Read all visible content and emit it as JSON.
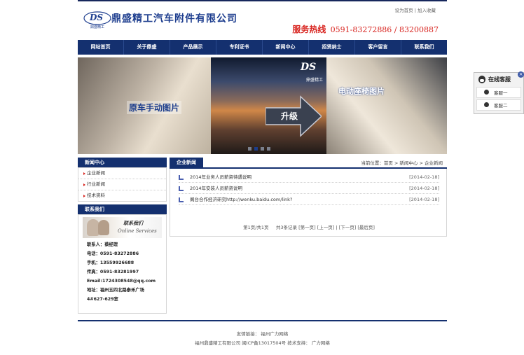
{
  "header": {
    "logo_text": "DS",
    "logo_sub": "鼎盛精工",
    "company_name": "鼎盛精工汽车附件有限公司",
    "links": [
      "设为首页",
      "加入收藏"
    ],
    "hotline_label": "服务热线",
    "hotline_numbers": "0591-83272886 / 83200887"
  },
  "nav": [
    "网站首页",
    "关于鼎盛",
    "产品展示",
    "专利证书",
    "新闻中心",
    "招贤纳士",
    "客户留言",
    "联系我们"
  ],
  "banner": {
    "logo_text": "DS",
    "logo_sub": "鼎盛精工",
    "left_caption": "原车手动图片",
    "right_caption": "电动座椅图片",
    "center_caption": "升级",
    "slides": 4,
    "active_slide": 2
  },
  "sidebar": {
    "news_title": "新闻中心",
    "news_items": [
      "企业新闻",
      "行业新闻",
      "技术资料"
    ],
    "contact_title": "联系我们",
    "contact_image_title": "联系我们",
    "contact_image_sub": "Online Services",
    "contact_lines": [
      "联系人：蔡经理",
      "电话：0591-83272886",
      "手机：13559926688",
      "传真：0591-83281997",
      "Email:1724308548@qq.com",
      "地址：福州五四北路泰禾广场",
      "4#627-629室"
    ]
  },
  "main": {
    "section_title": "企业新闻",
    "breadcrumb": "当前位置：首页 > 新闻中心 > 企业新闻",
    "rows": [
      {
        "title": "2014年业务人员薪资待遇说明",
        "date": "[2014-02-18]"
      },
      {
        "title": "2014年安装人员薪资说明",
        "date": "[2014-02-18]"
      },
      {
        "title": "阁台合作经济研究http://wenku.baidu.com/link?",
        "date": "[2014-02-18]"
      }
    ],
    "pager": {
      "info": "第1页/共1页",
      "count": "共3条记录",
      "first": "[第一页]",
      "prev": "[上一页]",
      "next": "[下一页]",
      "last": "[最后页]"
    }
  },
  "footer": {
    "line1": "友情链接：  福州广力网络",
    "line2": "福州鼎盛精工有限公司 闽ICP备13017504号  技术支持：  广力网络"
  },
  "service": {
    "title": "在线客服",
    "items": [
      "客服一",
      "客服二"
    ]
  },
  "colors": {
    "navy": "#14306f",
    "red": "#d8241f",
    "brand_blue": "#1e3e8f"
  }
}
